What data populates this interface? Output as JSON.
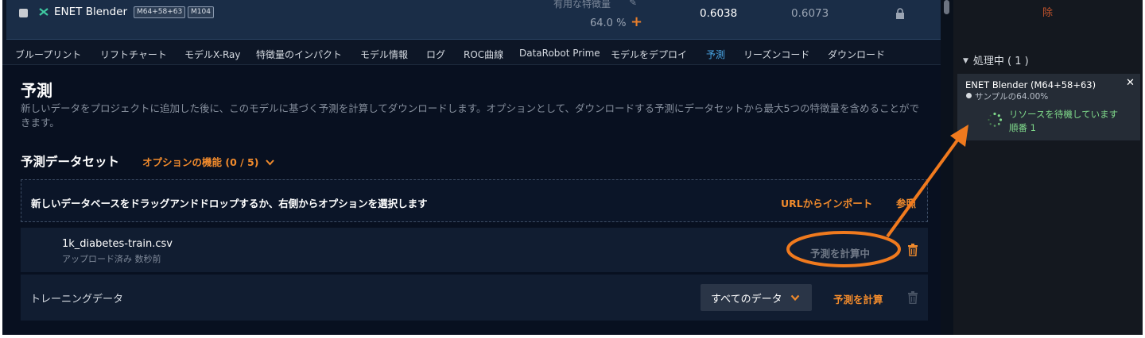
{
  "model_row": {
    "name": "ENET Blender",
    "badge_1": "M64+58+63",
    "badge_2": "M104",
    "feature_label": "有用な特徴量",
    "sample_pct": "64.0 %",
    "score_validation": "0.6038",
    "score_cv": "0.6073"
  },
  "tabs": [
    "ブループリント",
    "リフトチャート",
    "モデルX-Ray",
    "特徴量のインパクト",
    "モデル情報",
    "ログ",
    "ROC曲線",
    "DataRobot Prime",
    "モデルをデプロイ",
    "予測",
    "リーズンコード",
    "ダウンロード"
  ],
  "active_tab": "予測",
  "page": {
    "title": "予測",
    "description": "新しいデータをプロジェクトに追加した後に、このモデルに基づく予測を計算してダウンロードします。オプションとして、ダウンロードする予測にデータセットから最大5つの特徴量を含めることができます。",
    "section_title": "予測データセット",
    "options_link": "オプションの機能 (0 / 5)"
  },
  "dropzone": {
    "text": "新しいデータベースをドラッグアンドドロップするか、右側からオプションを選択します",
    "import_url": "URLからインポート",
    "browse": "参照"
  },
  "dataset": {
    "name": "1k_diabetes-train.csv",
    "status": "アップロード済み 数秒前",
    "action": "予測を計算中"
  },
  "training": {
    "label": "トレーニングデータ",
    "select_value": "すべてのデータ",
    "action": "予測を計算"
  },
  "right_panel": {
    "top_text": "除",
    "header": "処理中 ( 1 )",
    "job": {
      "title": "ENET Blender (M64+58+63)",
      "sample": "サンプルの64.00%",
      "status": "リソースを待機しています",
      "queue": "順番 1"
    }
  },
  "colors": {
    "accent": "#f08a2c",
    "active_tab": "#4aa8e8",
    "status_green": "#7fd88a",
    "annotation": "#f07a1e"
  }
}
